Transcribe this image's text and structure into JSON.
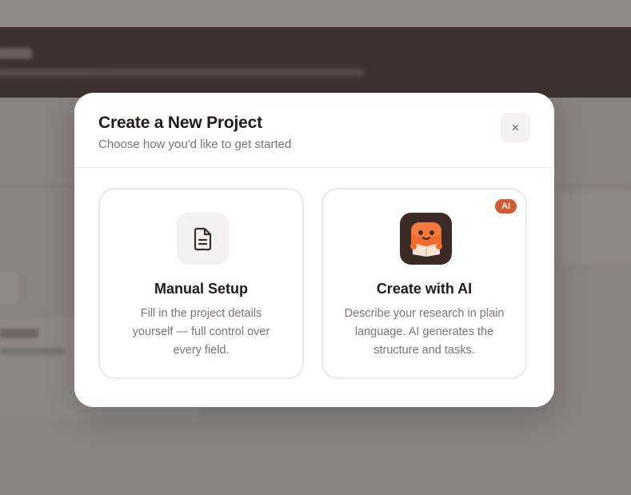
{
  "modal": {
    "title": "Create a New Project",
    "subtitle": "Choose how you'd like to get started",
    "close_label": "×"
  },
  "options": [
    {
      "title": "Manual Setup",
      "description": "Fill in the project details yourself — full control over every field.",
      "icon": "document-icon"
    },
    {
      "title": "Create with AI",
      "description": "Describe your research in plain language. AI generates the structure and tasks.",
      "icon": "ai-mascot-icon",
      "badge": "AI"
    }
  ],
  "colors": {
    "accent": "#d85a2c",
    "mascot": "#f36b2a",
    "title_text": "#231b1a",
    "muted_text": "#7d7574"
  }
}
